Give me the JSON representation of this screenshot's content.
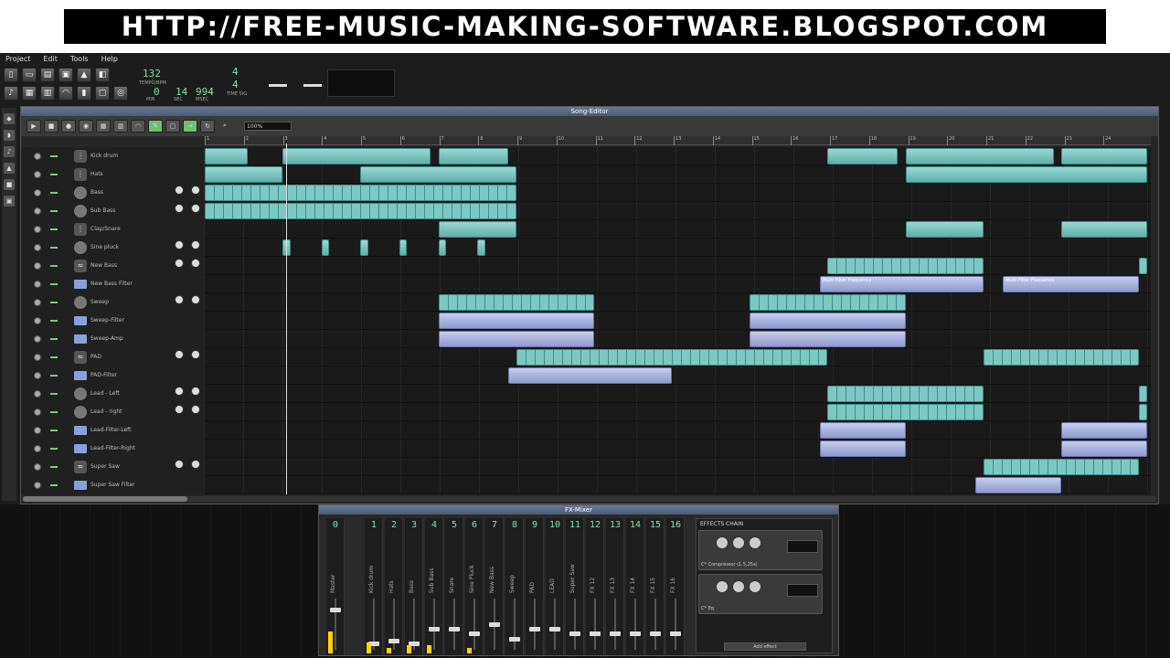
{
  "banner": {
    "text": "HTTP://FREE-MUSIC-MAKING-SOFTWARE.BLOGSPOT.COM"
  },
  "menu": [
    "Project",
    "Edit",
    "Tools",
    "Help"
  ],
  "transport": {
    "tempo": "132",
    "tempo_label": "TEMPO/BPM",
    "time_sig_top": "4",
    "time_sig_bottom": "4",
    "time_sig_label": "TIME SIG",
    "min": "0",
    "sec": "14",
    "msec": "994",
    "min_label": "MIN",
    "sec_label": "SEC",
    "msec_label": "MSEC"
  },
  "song_editor": {
    "title": "Song-Editor",
    "zoom": "100%",
    "timeline": [
      "1",
      "2",
      "3",
      "4",
      "5",
      "6",
      "7",
      "8",
      "9",
      "10",
      "11",
      "12",
      "13",
      "14",
      "15",
      "16",
      "17",
      "18",
      "19",
      "20",
      "21",
      "22",
      "23",
      "24"
    ],
    "tracks": [
      {
        "name": "Kick drum",
        "icon": "beat",
        "knobs": false,
        "clips": [
          {
            "s": 0,
            "e": 1.1,
            "k": "p",
            "l": ""
          },
          {
            "s": 2,
            "e": 5.8,
            "k": "p",
            "l": ""
          },
          {
            "s": 6,
            "e": 7.8,
            "k": "p",
            "l": ""
          },
          {
            "s": 16,
            "e": 17.8,
            "k": "p",
            "l": ""
          },
          {
            "s": 18,
            "e": 21.8,
            "k": "p",
            "l": ""
          },
          {
            "s": 22,
            "e": 24.2,
            "k": "p",
            "l": ""
          }
        ]
      },
      {
        "name": "Hats",
        "icon": "beat",
        "knobs": false,
        "clips": [
          {
            "s": 0,
            "e": 2,
            "k": "p",
            "l": ""
          },
          {
            "s": 4,
            "e": 8,
            "k": "p",
            "l": ""
          },
          {
            "s": 18,
            "e": 24.2,
            "k": "p",
            "l": ""
          }
        ]
      },
      {
        "name": "Bass",
        "icon": "knob",
        "knobs": true,
        "clips": [
          {
            "s": 0,
            "e": 8,
            "k": "pt",
            "l": ""
          }
        ]
      },
      {
        "name": "Sub Bass",
        "icon": "knob",
        "knobs": true,
        "clips": [
          {
            "s": 0,
            "e": 8,
            "k": "pt",
            "l": ""
          }
        ]
      },
      {
        "name": "Clap/Snare",
        "icon": "beat",
        "knobs": false,
        "clips": [
          {
            "s": 6,
            "e": 8,
            "k": "p",
            "l": ""
          },
          {
            "s": 18,
            "e": 20,
            "k": "p",
            "l": ""
          },
          {
            "s": 22,
            "e": 24.2,
            "k": "p",
            "l": ""
          }
        ]
      },
      {
        "name": "Sine pluck",
        "icon": "knob",
        "knobs": true,
        "clips": [
          {
            "s": 2,
            "e": 2.2,
            "k": "p",
            "l": ""
          },
          {
            "s": 3,
            "e": 3.2,
            "k": "p",
            "l": ""
          },
          {
            "s": 4,
            "e": 4.2,
            "k": "p",
            "l": ""
          },
          {
            "s": 5,
            "e": 5.2,
            "k": "p",
            "l": ""
          },
          {
            "s": 6,
            "e": 6.2,
            "k": "p",
            "l": ""
          },
          {
            "s": 7,
            "e": 7.2,
            "k": "p",
            "l": ""
          }
        ]
      },
      {
        "name": "New Bass",
        "icon": "synth",
        "knobs": true,
        "clips": [
          {
            "s": 16,
            "e": 20,
            "k": "pt",
            "l": ""
          },
          {
            "s": 24,
            "e": 24.2,
            "k": "pt",
            "l": ""
          }
        ]
      },
      {
        "name": "New Bass Filter",
        "icon": "folder",
        "knobs": false,
        "clips": [
          {
            "s": 15.8,
            "e": 20,
            "k": "a",
            "l": "Multi Filter Frequency"
          },
          {
            "s": 20.5,
            "e": 24,
            "k": "a",
            "l": "Multi Filter Frequency"
          }
        ]
      },
      {
        "name": "Sweep",
        "icon": "knob",
        "knobs": true,
        "clips": [
          {
            "s": 6,
            "e": 10,
            "k": "pt",
            "l": ""
          },
          {
            "s": 14,
            "e": 18,
            "k": "pt",
            "l": ""
          }
        ]
      },
      {
        "name": "Sweep-Filter",
        "icon": "folder",
        "knobs": false,
        "clips": [
          {
            "s": 6,
            "e": 10,
            "k": "a",
            "l": ""
          },
          {
            "s": 14,
            "e": 18,
            "k": "a",
            "l": ""
          }
        ]
      },
      {
        "name": "Sweep-Amp",
        "icon": "folder",
        "knobs": false,
        "clips": [
          {
            "s": 6,
            "e": 10,
            "k": "a",
            "l": ""
          },
          {
            "s": 14,
            "e": 18,
            "k": "a",
            "l": ""
          }
        ]
      },
      {
        "name": "PAD",
        "icon": "synth",
        "knobs": true,
        "clips": [
          {
            "s": 8,
            "e": 16,
            "k": "pt",
            "l": ""
          },
          {
            "s": 20,
            "e": 24,
            "k": "pt",
            "l": ""
          }
        ]
      },
      {
        "name": "PAD-Filter",
        "icon": "folder",
        "knobs": false,
        "clips": [
          {
            "s": 7.8,
            "e": 12,
            "k": "a",
            "l": ""
          }
        ]
      },
      {
        "name": "Lead - Left",
        "icon": "knob",
        "knobs": true,
        "clips": [
          {
            "s": 16,
            "e": 20,
            "k": "pt",
            "l": ""
          },
          {
            "s": 24,
            "e": 24.2,
            "k": "pt",
            "l": ""
          }
        ]
      },
      {
        "name": "Lead - right",
        "icon": "knob",
        "knobs": true,
        "clips": [
          {
            "s": 16,
            "e": 20,
            "k": "pt",
            "l": ""
          },
          {
            "s": 24,
            "e": 24.2,
            "k": "pt",
            "l": ""
          }
        ]
      },
      {
        "name": "Lead-Filter-Left",
        "icon": "folder",
        "knobs": false,
        "clips": [
          {
            "s": 15.8,
            "e": 18,
            "k": "a",
            "l": ""
          },
          {
            "s": 22,
            "e": 24.2,
            "k": "a",
            "l": ""
          }
        ]
      },
      {
        "name": "Lead-Filter-Right",
        "icon": "folder",
        "knobs": false,
        "clips": [
          {
            "s": 15.8,
            "e": 18,
            "k": "a",
            "l": ""
          },
          {
            "s": 22,
            "e": 24.2,
            "k": "a",
            "l": ""
          }
        ]
      },
      {
        "name": "Super Saw",
        "icon": "synth",
        "knobs": true,
        "clips": [
          {
            "s": 20,
            "e": 24,
            "k": "pt",
            "l": ""
          }
        ]
      },
      {
        "name": "Super Saw Filter",
        "icon": "folder",
        "knobs": false,
        "clips": [
          {
            "s": 19.8,
            "e": 22,
            "k": "a",
            "l": ""
          }
        ]
      }
    ]
  },
  "fx_mixer": {
    "title": "FX-Mixer",
    "channels": [
      {
        "num": "0",
        "name": "Master",
        "fader": 0.2,
        "meter": 0.4
      },
      {
        "num": "1",
        "name": "Kick drum",
        "fader": 0.9,
        "meter": 0.2
      },
      {
        "num": "2",
        "name": "Hats",
        "fader": 0.85,
        "meter": 0.1
      },
      {
        "num": "3",
        "name": "Bass",
        "fader": 0.9,
        "meter": 0.15
      },
      {
        "num": "4",
        "name": "Sub Bass",
        "fader": 0.6,
        "meter": 0.15
      },
      {
        "num": "5",
        "name": "Snare",
        "fader": 0.6,
        "meter": 0
      },
      {
        "num": "6",
        "name": "Sine Pluck",
        "fader": 0.7,
        "meter": 0.1
      },
      {
        "num": "7",
        "name": "New Bass",
        "fader": 0.5,
        "meter": 0
      },
      {
        "num": "8",
        "name": "Sweep",
        "fader": 0.8,
        "meter": 0
      },
      {
        "num": "9",
        "name": "PAD",
        "fader": 0.6,
        "meter": 0
      },
      {
        "num": "10",
        "name": "LEAD",
        "fader": 0.6,
        "meter": 0
      },
      {
        "num": "11",
        "name": "Super Saw",
        "fader": 0.7,
        "meter": 0
      },
      {
        "num": "12",
        "name": "FX 12",
        "fader": 0.7,
        "meter": 0
      },
      {
        "num": "13",
        "name": "FX 13",
        "fader": 0.7,
        "meter": 0
      },
      {
        "num": "14",
        "name": "FX 14",
        "fader": 0.7,
        "meter": 0
      },
      {
        "num": "15",
        "name": "FX 15",
        "fader": 0.7,
        "meter": 0
      },
      {
        "num": "16",
        "name": "FX 16",
        "fader": 0.7,
        "meter": 0
      }
    ],
    "chain_label": "EFFECTS CHAIN",
    "effects": [
      "C* Compressor (1.5,25s)",
      "C* Eq"
    ],
    "add_label": "Add effect"
  }
}
